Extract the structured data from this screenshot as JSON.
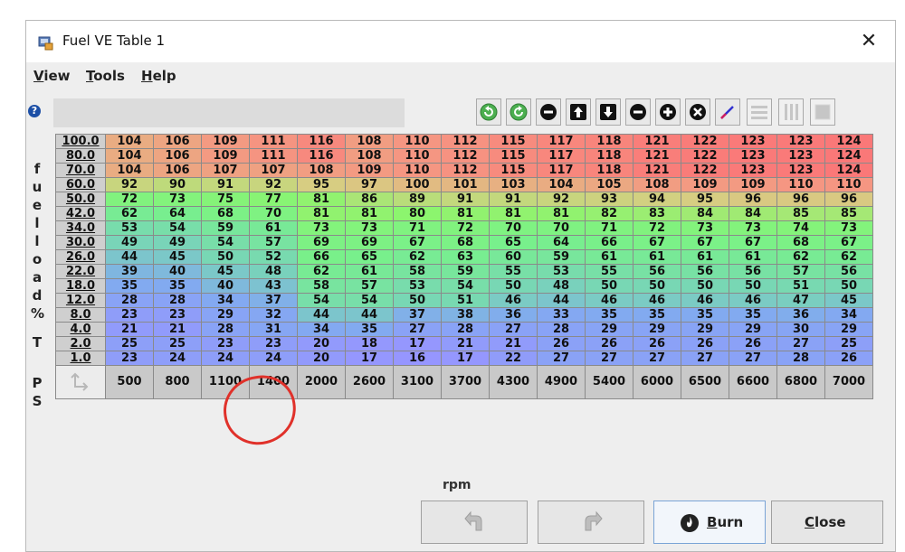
{
  "window": {
    "title": "Fuel VE Table 1"
  },
  "menu": [
    {
      "label": "View",
      "mnemonic": "V",
      "rest": "iew"
    },
    {
      "label": "Tools",
      "mnemonic": "T",
      "rest": "ools"
    },
    {
      "label": "Help",
      "mnemonic": "H",
      "rest": "elp"
    }
  ],
  "toolbar_icons": [
    "rotate-left-icon",
    "rotate-right-icon",
    "minus-circle-icon",
    "arrow-up-icon",
    "arrow-down-icon",
    "minus-circle-icon",
    "plus-circle-icon",
    "close-circle-icon",
    "pencil-icon",
    "horizontal-lines-icon",
    "vertical-lines-icon",
    "fill-icon"
  ],
  "y_axis": {
    "label_letters": [
      "f",
      "u",
      "e",
      "l",
      "l",
      "o",
      "a",
      "d",
      "%",
      "T",
      "P",
      "S"
    ],
    "values": [
      "100.0",
      "80.0",
      "70.0",
      "60.0",
      "50.0",
      "42.0",
      "34.0",
      "30.0",
      "26.0",
      "22.0",
      "18.0",
      "12.0",
      "8.0",
      "4.0",
      "2.0",
      "1.0"
    ]
  },
  "x_axis": {
    "label": "rpm",
    "values": [
      "500",
      "800",
      "1100",
      "1400",
      "2000",
      "2600",
      "3100",
      "3700",
      "4300",
      "4900",
      "5400",
      "6000",
      "6500",
      "6600",
      "6800",
      "7000"
    ]
  },
  "table": [
    [
      "104",
      "106",
      "109",
      "111",
      "116",
      "108",
      "110",
      "112",
      "115",
      "117",
      "118",
      "121",
      "122",
      "123",
      "123",
      "124"
    ],
    [
      "104",
      "106",
      "109",
      "111",
      "116",
      "108",
      "110",
      "112",
      "115",
      "117",
      "118",
      "121",
      "122",
      "123",
      "123",
      "124"
    ],
    [
      "104",
      "106",
      "107",
      "107",
      "108",
      "109",
      "110",
      "112",
      "115",
      "117",
      "118",
      "121",
      "122",
      "123",
      "123",
      "124"
    ],
    [
      "92",
      "90",
      "91",
      "92",
      "95",
      "97",
      "100",
      "101",
      "103",
      "104",
      "105",
      "108",
      "109",
      "109",
      "110",
      "110"
    ],
    [
      "72",
      "73",
      "75",
      "77",
      "81",
      "86",
      "89",
      "91",
      "91",
      "92",
      "93",
      "94",
      "95",
      "96",
      "96",
      "96"
    ],
    [
      "62",
      "64",
      "68",
      "70",
      "81",
      "81",
      "80",
      "81",
      "81",
      "81",
      "82",
      "83",
      "84",
      "84",
      "85",
      "85"
    ],
    [
      "53",
      "54",
      "59",
      "61",
      "73",
      "73",
      "71",
      "72",
      "70",
      "70",
      "71",
      "72",
      "73",
      "73",
      "74",
      "73"
    ],
    [
      "49",
      "49",
      "54",
      "57",
      "69",
      "69",
      "67",
      "68",
      "65",
      "64",
      "66",
      "67",
      "67",
      "67",
      "68",
      "67"
    ],
    [
      "44",
      "45",
      "50",
      "52",
      "66",
      "65",
      "62",
      "63",
      "60",
      "59",
      "61",
      "61",
      "61",
      "61",
      "62",
      "62"
    ],
    [
      "39",
      "40",
      "45",
      "48",
      "62",
      "61",
      "58",
      "59",
      "55",
      "53",
      "55",
      "56",
      "56",
      "56",
      "57",
      "56"
    ],
    [
      "35",
      "35",
      "40",
      "43",
      "58",
      "57",
      "53",
      "54",
      "50",
      "48",
      "50",
      "50",
      "50",
      "50",
      "51",
      "50"
    ],
    [
      "28",
      "28",
      "34",
      "37",
      "54",
      "54",
      "50",
      "51",
      "46",
      "44",
      "46",
      "46",
      "46",
      "46",
      "47",
      "45"
    ],
    [
      "23",
      "23",
      "29",
      "32",
      "44",
      "44",
      "37",
      "38",
      "36",
      "33",
      "35",
      "35",
      "35",
      "35",
      "36",
      "34"
    ],
    [
      "21",
      "21",
      "28",
      "31",
      "34",
      "35",
      "27",
      "28",
      "27",
      "28",
      "29",
      "29",
      "29",
      "29",
      "30",
      "29"
    ],
    [
      "25",
      "25",
      "23",
      "23",
      "20",
      "18",
      "17",
      "21",
      "21",
      "26",
      "26",
      "26",
      "26",
      "26",
      "27",
      "25"
    ],
    [
      "23",
      "24",
      "24",
      "24",
      "20",
      "17",
      "16",
      "17",
      "22",
      "27",
      "27",
      "27",
      "27",
      "27",
      "28",
      "26"
    ]
  ],
  "buttons": {
    "undo": "undo-icon",
    "redo": "redo-icon",
    "burn_mnemonic": "B",
    "burn_rest": "urn",
    "close_mnemonic": "C",
    "close_rest": "lose"
  },
  "annotation": {
    "color": "#e0312a"
  }
}
